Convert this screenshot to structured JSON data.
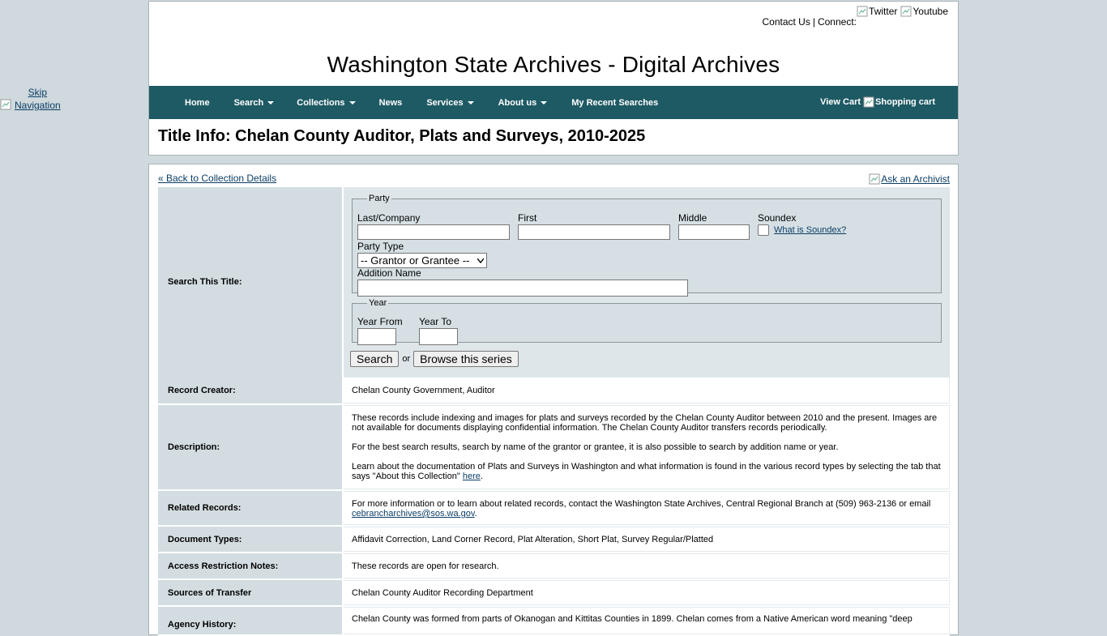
{
  "skip_nav": "Skip Navigation",
  "header": {
    "contact_us": "Contact Us",
    "separator": "|",
    "connect": "Connect:",
    "twitter_alt": "Twitter",
    "youtube_alt": "Youtube",
    "site_title": "Washington State Archives - Digital Archives",
    "page_title": "Title Info: Chelan County Auditor, Plats and Surveys, 2010-2025"
  },
  "nav": {
    "items": [
      {
        "label": "Home",
        "dropdown": false
      },
      {
        "label": "Search",
        "dropdown": true
      },
      {
        "label": "Collections",
        "dropdown": true
      },
      {
        "label": "News",
        "dropdown": false
      },
      {
        "label": "Services",
        "dropdown": true
      },
      {
        "label": "About us",
        "dropdown": true
      },
      {
        "label": "My Recent Searches",
        "dropdown": false
      }
    ],
    "view_cart": "View Cart",
    "cart_alt": "Shopping cart",
    "background": "#1e5a64"
  },
  "main": {
    "back_link": "« Back to Collection Details",
    "ask_archivist": "Ask an Archivist",
    "search_label": "Search This Title:",
    "party": {
      "legend": "Party",
      "last_label": "Last/Company",
      "last_value": "",
      "first_label": "First",
      "first_value": "",
      "middle_label": "Middle",
      "middle_value": "",
      "soundex_label": "Soundex",
      "soundex_link": "What is Soundex?",
      "party_type_label": "Party Type",
      "party_type_selected": "-- Grantor or Grantee --",
      "addition_label": "Addition Name",
      "addition_value": ""
    },
    "year": {
      "legend": "Year",
      "from_label": "Year From",
      "to_label": "Year To"
    },
    "search_button": "Search",
    "or_text": "or",
    "browse_button": "Browse this series",
    "rows": {
      "creator_label": "Record Creator:",
      "creator_value": "Chelan County Government, Auditor",
      "description_label": "Description:",
      "description_p1": "These records include indexing and images for plats and surveys recorded by the Chelan County Auditor between 2010 and the present. Images are not available for documents displaying confidential information. The Chelan County Auditor transfers records periodically.",
      "description_p2": "For the best search results, search by name of the grantor or grantee, it is also possible to search by addition name or year.",
      "description_p3": "Learn about the documentation of Plats and Surveys in Washington and what information is found in the various record types by selecting the tab that says \"About this Collection\"",
      "description_p3_link": "here",
      "related_label": "Related Records:",
      "related_value": "For more information or to learn about related records, contact the Washington State Archives, Central Regional Branch at (509) 963-2136 or email",
      "related_email": "cebrancharchives@sos.wa.gov",
      "doctypes_label": "Document Types:",
      "doctypes_value": "Affidavit Correction, Land Corner Record, Plat Alteration, Short Plat, Survey Regular/Platted",
      "access_label": "Access Restriction Notes:",
      "access_value": "These records are open for research.",
      "sources_label": "Sources of Transfer",
      "sources_value": "Chelan County Auditor Recording Department",
      "history_label": "Agency History:",
      "history_value": "Chelan County was formed from parts of Okanogan and Kittitas Counties in 1899. Chelan comes from a Native American word meaning \"deep"
    }
  }
}
